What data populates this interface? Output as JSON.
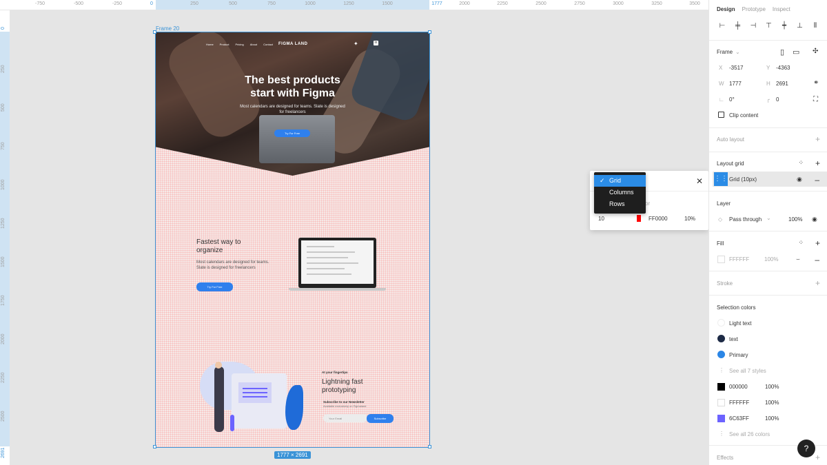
{
  "rulers": {
    "top": [
      "-750",
      "-500",
      "-250",
      "0",
      "250",
      "500",
      "750",
      "1000",
      "1250",
      "1500",
      "1777",
      "2000",
      "2250",
      "2500",
      "2750",
      "3000",
      "3250",
      "3500"
    ],
    "left": [
      "0",
      "250",
      "500",
      "750",
      "1000",
      "1250",
      "1500",
      "1750",
      "2000",
      "2250",
      "2500",
      "2691"
    ]
  },
  "frame": {
    "label": "Frame 20",
    "size_badge": "1777 × 2691",
    "nav": [
      "Home",
      "Product",
      "Pricing",
      "About",
      "Contact"
    ],
    "brand": "FIGMA LAND",
    "hero_title": "The best products\nstart with Figma",
    "hero_sub": "Most calendars are designed for teams. Slate is designed\nfor freelancers",
    "hero_button": "Try For Free",
    "sec2_title": "Fastest way to\norganize",
    "sec2_sub": "Most calendars are designed for teams.\nSlate is designed for freelancers",
    "sec2_button": "Try For Free",
    "sec3_eyebrow": "At your fingertips",
    "sec3_title": "Lightning fast\nprototyping",
    "sec3_news": "Subscribe to our Newsletter",
    "sec3_avail": "Available exclusivery on Figmaland",
    "email_placeholder": "Your Email",
    "subscribe": "Subscribe"
  },
  "popover": {
    "size": "10",
    "color": "FF0000",
    "opacity": "10%",
    "hint": "or",
    "menu": [
      "Grid",
      "Columns",
      "Rows"
    ],
    "selected": "Grid"
  },
  "panel": {
    "tabs": [
      "Design",
      "Prototype",
      "Inspect"
    ],
    "frame_title": "Frame",
    "x_label": "X",
    "x": "-3517",
    "y_label": "Y",
    "y": "-4363",
    "w_label": "W",
    "w": "1777",
    "h_label": "H",
    "h": "2691",
    "rotation": "0°",
    "radius": "0",
    "clip_content": "Clip content",
    "auto_layout": "Auto layout",
    "layout_grid": "Layout grid",
    "grid_item": "Grid (10px)",
    "layer": "Layer",
    "blend": "Pass through",
    "layer_opacity": "100%",
    "fill": "Fill",
    "fill_hex": "FFFFFF",
    "fill_opacity": "100%",
    "stroke": "Stroke",
    "selection_colors": "Selection colors",
    "styles": [
      {
        "name": "Light text",
        "color": "#ffffff"
      },
      {
        "name": "text",
        "color": "#1d2a45"
      },
      {
        "name": "Primary",
        "color": "#2b86e6"
      }
    ],
    "see_all_styles": "See all 7 styles",
    "colors": [
      {
        "hex": "000000",
        "opacity": "100%",
        "color": "#000000"
      },
      {
        "hex": "FFFFFF",
        "opacity": "100%",
        "color": "#ffffff"
      },
      {
        "hex": "6C63FF",
        "opacity": "100%",
        "color": "#6c63ff"
      }
    ],
    "see_all_colors": "See all 26 colors",
    "effects": "Effects",
    "help": "?"
  }
}
